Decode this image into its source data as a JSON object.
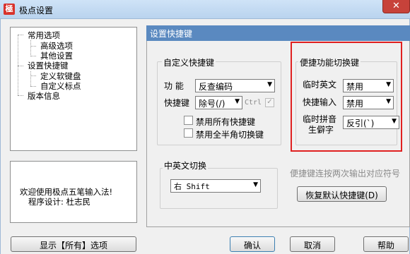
{
  "window": {
    "title": "极点设置",
    "close_symbol": "✕",
    "app_icon_glyph": "極"
  },
  "tree": {
    "items": [
      {
        "label": "常用选项",
        "level": 0
      },
      {
        "label": "高级选项",
        "level": 1
      },
      {
        "label": "其他设置",
        "level": 1
      },
      {
        "label": "设置快捷键",
        "level": 0
      },
      {
        "label": "定义软键盘",
        "level": 1
      },
      {
        "label": "自定义标点",
        "level": 1
      },
      {
        "label": "版本信息",
        "level": 0
      }
    ]
  },
  "welcome": {
    "line1": "欢迎使用极点五笔输入法!",
    "line2": "程序设计: 杜志民"
  },
  "panel": {
    "header": "设置快捷键",
    "custom_group": {
      "title": "自定义快捷键",
      "function_label": "功  能",
      "function_value": "反查编码",
      "shortcut_label": "快捷键",
      "shortcut_value": "除号(/)",
      "ctrl_label": "Ctrl",
      "disable_all_label": "禁用所有快捷键",
      "disable_halfwidth_label": "禁用全半角切换键"
    },
    "toggle_group": {
      "title": "便捷功能切换键",
      "temp_english_label": "临时英文",
      "temp_english_value": "禁用",
      "temp_input_label": "快捷输入",
      "temp_input_value": "禁用",
      "temp_pinyin_label_1": "临时拼音",
      "temp_pinyin_label_2": "生僻字",
      "temp_pinyin_value": "反引(`)"
    },
    "cn_en_group": {
      "title": "中英文切换",
      "value": "右 Shift"
    },
    "hint": "便捷键连按两次输出对应符号",
    "restore_button": "恢复默认快捷键(D)"
  },
  "bottom": {
    "show_all_button": "显示【所有】选项",
    "ok_button": "确认",
    "cancel_button": "取消",
    "help_button": "帮助"
  },
  "colors": {
    "panel_header": "#5a89c0",
    "highlight_box": "#e02020",
    "app_icon": "#d8322c"
  }
}
